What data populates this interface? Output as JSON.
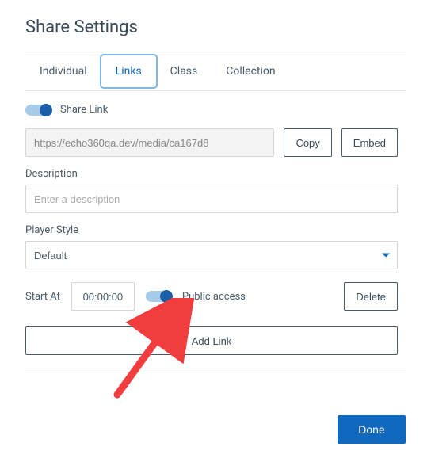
{
  "title": "Share Settings",
  "tabs": [
    {
      "label": "Individual"
    },
    {
      "label": "Links"
    },
    {
      "label": "Class"
    },
    {
      "label": "Collection"
    }
  ],
  "active_tab": 1,
  "share_link_toggle": {
    "label": "Share Link",
    "on": true
  },
  "url": {
    "value": "https://echo360qa.dev/media/ca167d8"
  },
  "copy_label": "Copy",
  "embed_label": "Embed",
  "description": {
    "label": "Description",
    "placeholder": "Enter a description",
    "value": ""
  },
  "player_style": {
    "label": "Player Style",
    "value": "Default",
    "options": [
      "Default"
    ]
  },
  "start_at": {
    "label": "Start At",
    "value": "00:00:00"
  },
  "public_access": {
    "label": "Public access",
    "on": true
  },
  "delete_label": "Delete",
  "add_link_label": "Add Link",
  "done_label": "Done"
}
